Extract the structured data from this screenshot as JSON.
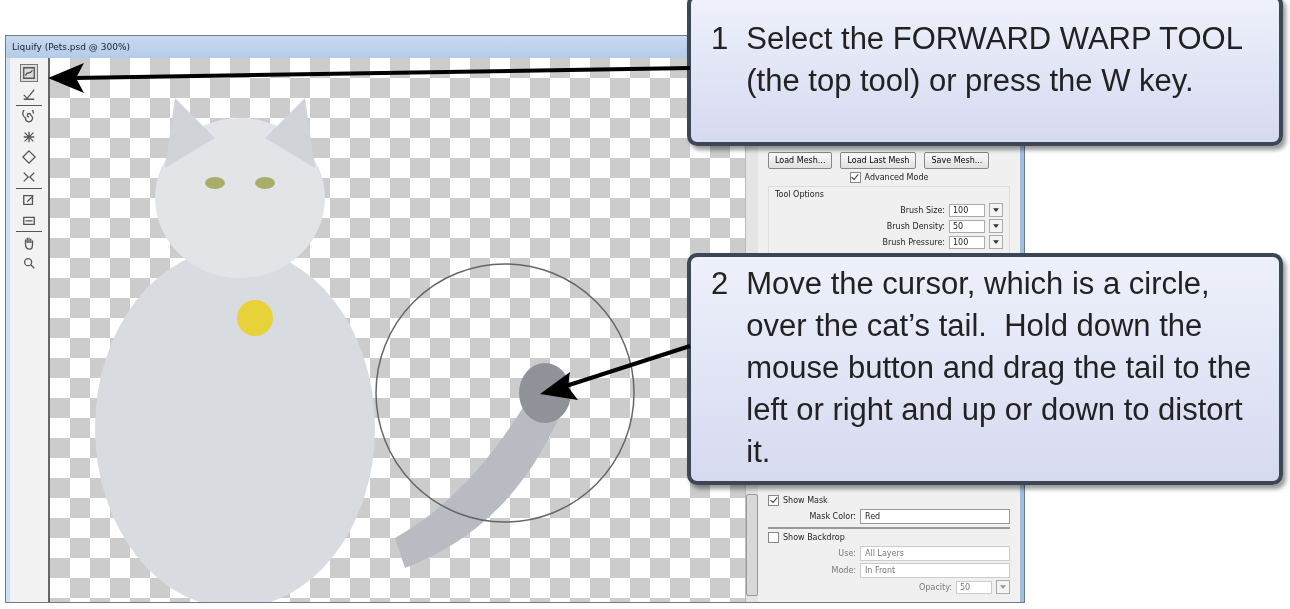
{
  "window": {
    "title": "Liquify (Pets.psd @ 300%)"
  },
  "tool_groups": [
    [
      {
        "kind": "warp",
        "selected": true
      },
      {
        "kind": "reconstruct",
        "selected": false
      }
    ],
    [
      {
        "kind": "twirl",
        "selected": false
      },
      {
        "kind": "pucker",
        "selected": false
      },
      {
        "kind": "bloat",
        "selected": false
      },
      {
        "kind": "push",
        "selected": false
      }
    ],
    [
      {
        "kind": "freeze",
        "selected": false
      },
      {
        "kind": "thaw",
        "selected": false
      }
    ],
    [
      {
        "kind": "hand",
        "selected": false
      },
      {
        "kind": "zoom",
        "selected": false
      }
    ]
  ],
  "panel": {
    "mesh_buttons": [
      "Load Mesh...",
      "Load Last Mesh",
      "Save Mesh..."
    ],
    "advanced_mode": {
      "label": "Advanced Mode",
      "checked": true
    },
    "tool_options": {
      "title": "Tool Options",
      "fields": [
        {
          "label": "Brush Size:",
          "value": "100"
        },
        {
          "label": "Brush Density:",
          "value": "50"
        },
        {
          "label": "Brush Pressure:",
          "value": "100"
        }
      ]
    },
    "show_mask": {
      "label": "Show Mask",
      "checked": true
    },
    "mask_color": {
      "label": "Mask Color:",
      "value": "Red"
    },
    "show_backdrop": {
      "label": "Show Backdrop",
      "checked": false
    },
    "backdrop_fields": [
      {
        "kind": "select",
        "label": "Use:",
        "value": "All Layers",
        "disabled": true
      },
      {
        "kind": "select",
        "label": "Mode:",
        "value": "In Front",
        "disabled": true
      },
      {
        "kind": "spin",
        "label": "Opacity:",
        "value": "50",
        "disabled": true
      }
    ]
  },
  "callouts": [
    {
      "number": "1",
      "text": "Select the FORWARD WARP TOOL (the top tool) or press the W key."
    },
    {
      "number": "2",
      "text": "Move the cursor, which is a circle, over the cat’s tail.  Hold down the mouse button and drag the tail to the left or right and up or down to distort it."
    }
  ]
}
